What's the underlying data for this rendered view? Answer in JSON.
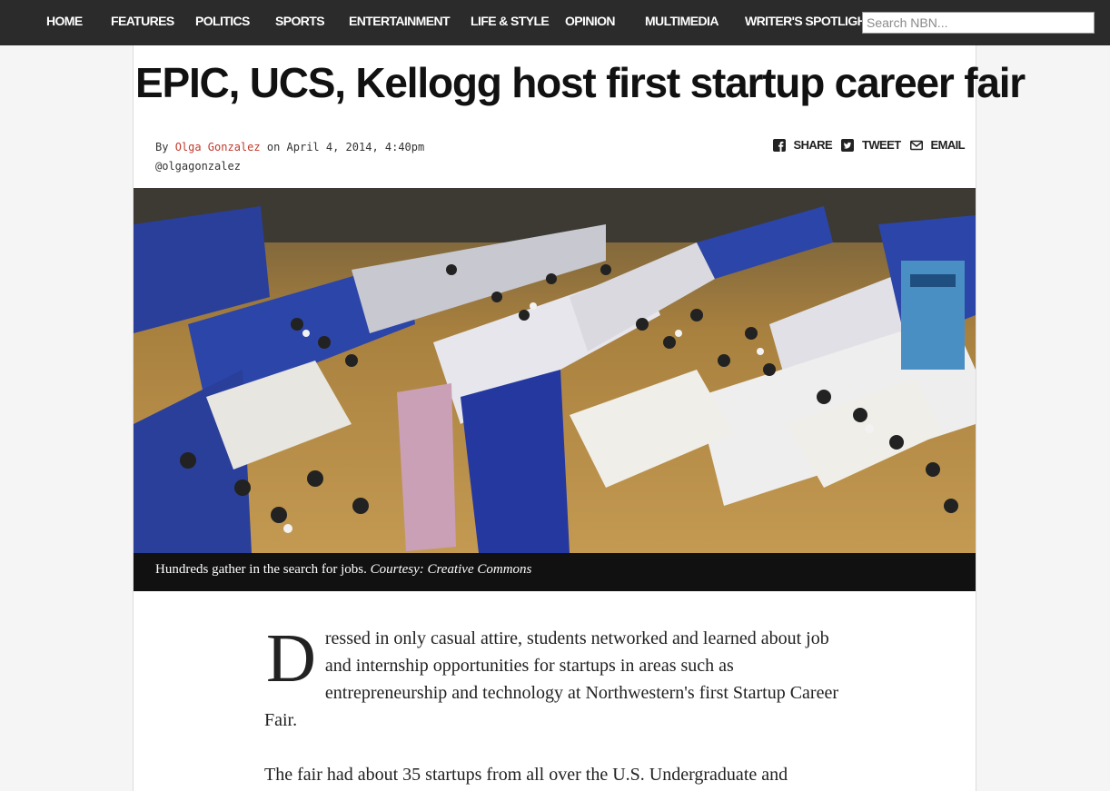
{
  "nav": {
    "items": [
      "HOME",
      "FEATURES",
      "POLITICS",
      "SPORTS",
      "ENTERTAINMENT",
      "LIFE & STYLE",
      "OPINION",
      "MULTIMEDIA",
      "WRITER'S SPOTLIGHT"
    ],
    "search_placeholder": "Search NBN..."
  },
  "article": {
    "headline": "EPIC, UCS, Kellogg host first startup career fair",
    "byline": {
      "prefix": "By",
      "author": "Olga Gonzalez",
      "date": "on April 4, 2014, 4:40pm",
      "handle": "@olgagonzalez"
    },
    "social": {
      "share": "SHARE",
      "tweet": "TWEET",
      "email": "EMAIL"
    },
    "photo_caption": "Hundreds gather in the search for jobs.",
    "photo_credit": "Courtesy: Creative Commons",
    "body": {
      "dropcap": "D",
      "p1_rest": "ressed in only casual attire, students networked and learned about job and internship opportunities for startups in areas such as entrepreneurship and technology at Northwestern's first Startup Career Fair.",
      "p2": "The fair had about 35 startups from all over the U.S. Undergraduate and"
    }
  },
  "colors": {
    "nav_bg": "#2b2b2b",
    "accent": "#c0392b",
    "caption_bg": "#111111"
  }
}
